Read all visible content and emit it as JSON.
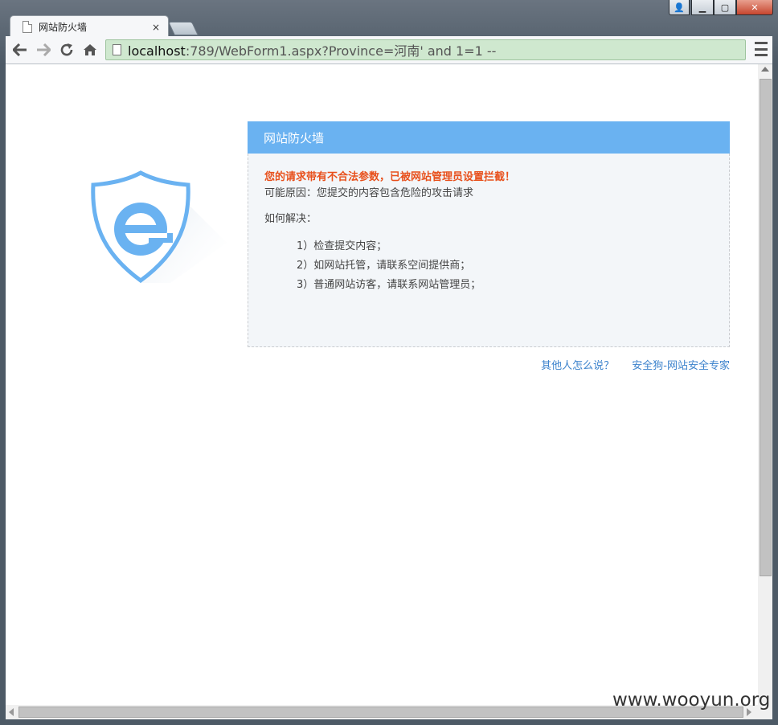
{
  "browser": {
    "tab_title": "网站防火墙",
    "tab_close": "×",
    "url_host": "localhost",
    "url_rest": ":789/WebForm1.aspx?Province=河南' and 1=1 --"
  },
  "panel": {
    "header": "网站防火墙",
    "error_title": "您的请求带有不合法参数，已被网站管理员设置拦截！",
    "reason": "可能原因：您提交的内容包含危险的攻击请求",
    "how_label": "如何解决：",
    "steps": [
      "1）检查提交内容；",
      "2）如网站托管，请联系空间提供商；",
      "3）普通网站访客，请联系网站管理员；"
    ]
  },
  "links": {
    "others": "其他人怎么说？",
    "vendor": "安全狗-网站安全专家"
  },
  "watermark": "www.wooyun.org",
  "colors": {
    "header_bg": "#6ab2f1",
    "error_text": "#e8501c",
    "link": "#3b82cc",
    "omnibox_bg": "#cfe8cf"
  },
  "icons": {
    "logo": "shield-e-logo-icon"
  }
}
